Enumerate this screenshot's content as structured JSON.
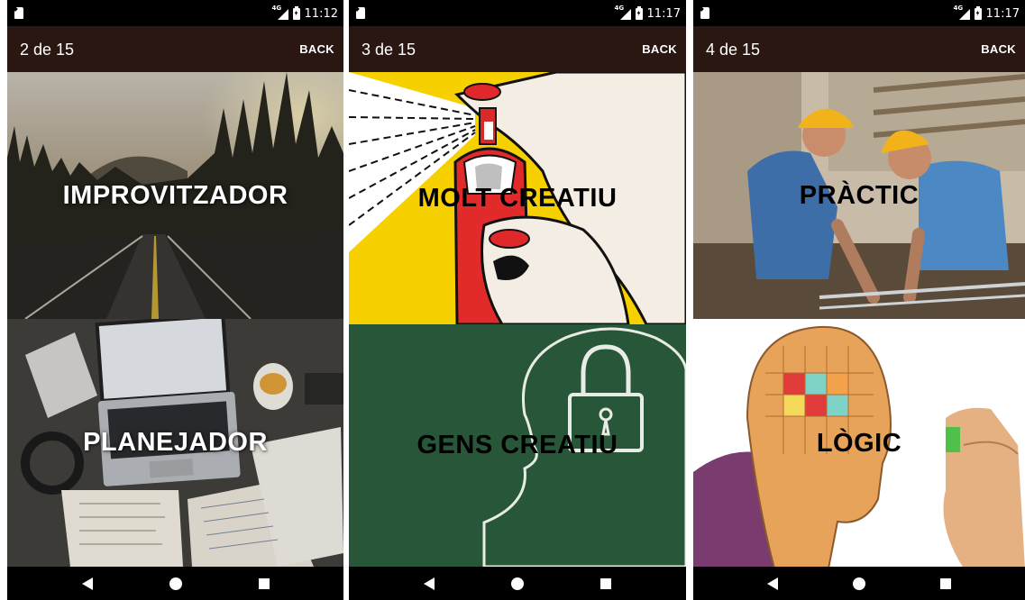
{
  "screens": [
    {
      "status_time": "11:12",
      "network": "4G",
      "title": "2 de 15",
      "back_label": "BACK",
      "tiles": [
        {
          "label": "IMPROVITZADOR",
          "label_color": "#ffffff",
          "image": "forest-road-photo"
        },
        {
          "label": "PLANEJADOR",
          "label_color": "#ffffff",
          "image": "desk-laptop-planner-photo"
        }
      ]
    },
    {
      "status_time": "11:17",
      "network": "4G",
      "title": "3 de 15",
      "back_label": "BACK",
      "tiles": [
        {
          "label": "MOLT CREATIU",
          "label_color": "#000000",
          "image": "pop-art-spray-can"
        },
        {
          "label": "GENS CREATIU",
          "label_color": "#000000",
          "image": "chalkboard-head-padlock"
        }
      ]
    },
    {
      "status_time": "11:17",
      "network": "4G",
      "title": "4 de 15",
      "back_label": "BACK",
      "tiles": [
        {
          "label": "PRÀCTIC",
          "label_color": "#000000",
          "image": "construction-workers-photo"
        },
        {
          "label": "LÒGIC",
          "label_color": "#000000",
          "image": "puzzle-head-illustration"
        }
      ]
    }
  ],
  "colors": {
    "app_bar": "#2a1711",
    "system_bars": "#000000"
  },
  "icons": {
    "nav": [
      "back-triangle-icon",
      "home-circle-icon",
      "recents-square-icon"
    ],
    "status": [
      "sd-card-icon",
      "signal-icon",
      "battery-charging-icon"
    ]
  }
}
